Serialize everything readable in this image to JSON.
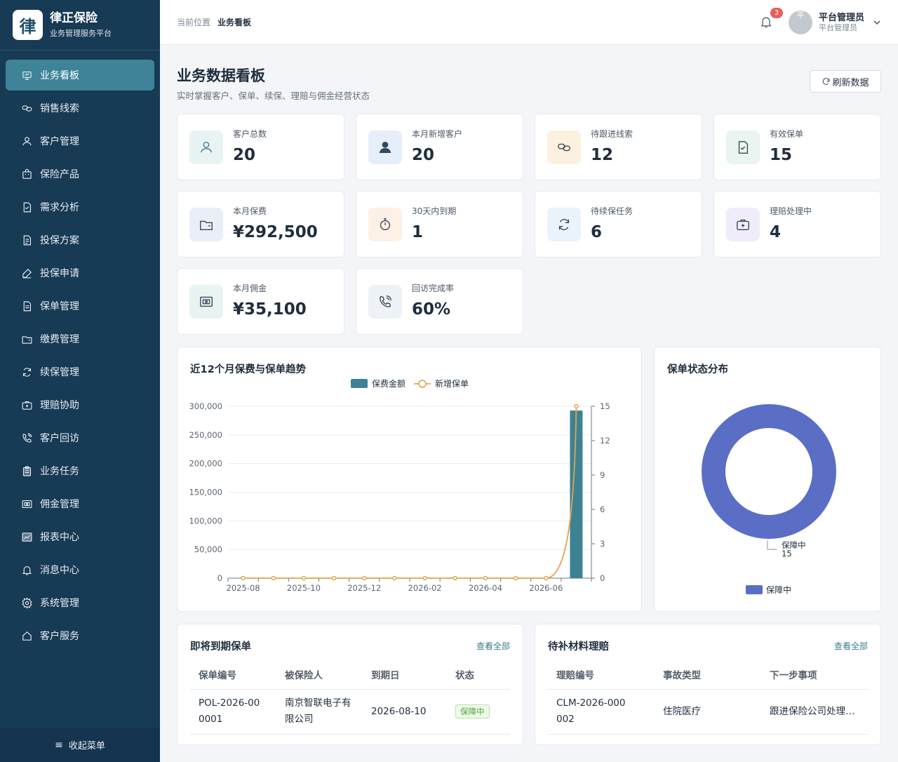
{
  "brand": {
    "logo": "律",
    "name": "律正保险",
    "subtitle": "业务管理服务平台"
  },
  "sidebar": {
    "items": [
      {
        "label": "业务看板",
        "icon": "dashboard-icon",
        "active": true
      },
      {
        "label": "销售线索",
        "icon": "link-icon"
      },
      {
        "label": "客户管理",
        "icon": "user-icon"
      },
      {
        "label": "保险产品",
        "icon": "shopping-bag-icon"
      },
      {
        "label": "需求分析",
        "icon": "checklist-icon"
      },
      {
        "label": "投保方案",
        "icon": "document-list-icon"
      },
      {
        "label": "投保申请",
        "icon": "pen-icon"
      },
      {
        "label": "保单管理",
        "icon": "document-icon"
      },
      {
        "label": "缴费管理",
        "icon": "wallet-icon"
      },
      {
        "label": "续保管理",
        "icon": "refresh-icon"
      },
      {
        "label": "理赔协助",
        "icon": "medical-kit-icon"
      },
      {
        "label": "客户回访",
        "icon": "phone-icon"
      },
      {
        "label": "业务任务",
        "icon": "clipboard-icon"
      },
      {
        "label": "佣金管理",
        "icon": "money-icon"
      },
      {
        "label": "报表中心",
        "icon": "chart-icon"
      },
      {
        "label": "消息中心",
        "icon": "bell-icon"
      },
      {
        "label": "系统管理",
        "icon": "gear-icon"
      },
      {
        "label": "客户服务",
        "icon": "home-icon"
      }
    ],
    "collapse_label": "收起菜单"
  },
  "header": {
    "breadcrumb_label": "当前位置",
    "breadcrumb_current": "业务看板",
    "notification_count": "3",
    "avatar_text": "平",
    "user_name": "平台管理员",
    "user_role": "平台管理员"
  },
  "page": {
    "title": "业务数据看板",
    "subtitle": "实时掌握客户、保单、续保、理赔与佣金经营状态",
    "refresh_label": "刷新数据"
  },
  "stats": [
    {
      "label": "客户总数",
      "value": "20",
      "icon": "user-icon",
      "bg": "#e9f3f4",
      "color": "#3b7d8e"
    },
    {
      "label": "本月新增客户",
      "value": "20",
      "icon": "user-solid-icon",
      "bg": "#e6eefa",
      "color": "#2c4a60"
    },
    {
      "label": "待跟进线索",
      "value": "12",
      "icon": "link-icon",
      "bg": "#fcf1df",
      "color": "#3b4a58"
    },
    {
      "label": "有效保单",
      "value": "15",
      "icon": "document-check-icon",
      "bg": "#e9f5ee",
      "color": "#3b4a58"
    },
    {
      "label": "本月保费",
      "value": "¥292,500",
      "icon": "wallet-icon",
      "bg": "#e9eef7",
      "color": "#3b4a58"
    },
    {
      "label": "30天内到期",
      "value": "1",
      "icon": "timer-icon",
      "bg": "#fdf0e4",
      "color": "#3b4a58"
    },
    {
      "label": "待续保任务",
      "value": "6",
      "icon": "refresh-icon",
      "bg": "#eaf2fb",
      "color": "#3b4a58"
    },
    {
      "label": "理赔处理中",
      "value": "4",
      "icon": "medical-kit-icon",
      "bg": "#f1ecfb",
      "color": "#3b4a58"
    },
    {
      "label": "本月佣金",
      "value": "¥35,100",
      "icon": "money-icon",
      "bg": "#e9f3f1",
      "color": "#3b4a58"
    },
    {
      "label": "回访完成率",
      "value": "60%",
      "icon": "phone-icon",
      "bg": "#eef2f6",
      "color": "#3b4a58"
    }
  ],
  "trend_panel": {
    "title": "近12个月保费与保单趋势"
  },
  "status_panel": {
    "title": "保单状态分布"
  },
  "chart_data": [
    {
      "type": "bar",
      "title": "近12个月保费与保单趋势",
      "categories": [
        "2025-08",
        "2025-09",
        "2025-10",
        "2025-11",
        "2025-12",
        "2026-01",
        "2026-02",
        "2026-03",
        "2026-04",
        "2026-05",
        "2026-06",
        "2026-07"
      ],
      "x_tick_labels": [
        "2025-08",
        "2025-10",
        "2025-12",
        "2026-02",
        "2026-04",
        "2026-06"
      ],
      "series": [
        {
          "name": "保费金额",
          "type": "bar",
          "axis": "left",
          "color": "#3d8293",
          "values": [
            0,
            0,
            0,
            0,
            0,
            0,
            0,
            0,
            0,
            0,
            0,
            292500
          ]
        },
        {
          "name": "新增保单",
          "type": "line",
          "axis": "right",
          "color": "#e3a24b",
          "values": [
            0,
            0,
            0,
            0,
            0,
            0,
            0,
            0,
            0,
            0,
            0,
            15
          ]
        }
      ],
      "y_left": {
        "ticks": [
          "0",
          "50,000",
          "100,000",
          "150,000",
          "200,000",
          "250,000",
          "300,000"
        ],
        "ylim": [
          0,
          300000
        ]
      },
      "y_right": {
        "ticks": [
          "0",
          "3",
          "6",
          "9",
          "12",
          "15"
        ],
        "ylim": [
          0,
          15
        ]
      },
      "legend": "top-center",
      "grid": true
    },
    {
      "type": "pie",
      "title": "保单状态分布",
      "slices": [
        {
          "name": "保障中",
          "value": 15,
          "color": "#5b6ec5"
        }
      ],
      "legend": "bottom-center"
    }
  ],
  "expiring": {
    "title": "即将到期保单",
    "link": "查看全部",
    "columns": [
      "保单编号",
      "被保险人",
      "到期日",
      "状态"
    ],
    "rows": [
      {
        "policy_no": "POL-2026-000001",
        "insured": "南京智联电子有限公司",
        "due": "2026-08-10",
        "status": "保障中"
      }
    ]
  },
  "claims": {
    "title": "待补材料理赔",
    "link": "查看全部",
    "columns": [
      "理赔编号",
      "事故类型",
      "下一步事项"
    ],
    "rows": [
      {
        "claim_no": "CLM-2026-000002",
        "type": "住院医疗",
        "next": "跟进保险公司处理…"
      }
    ]
  }
}
